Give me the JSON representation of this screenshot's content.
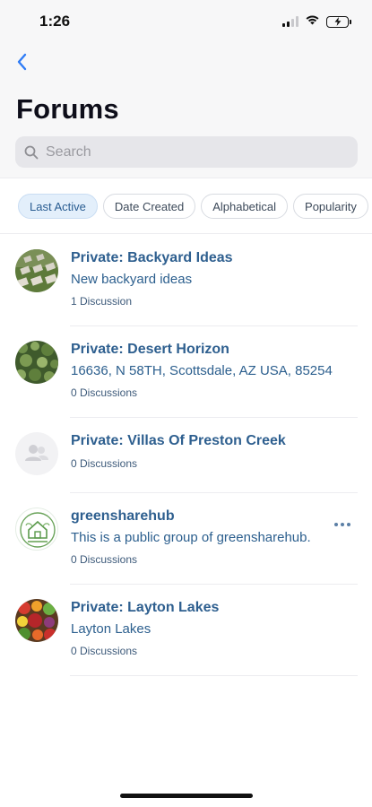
{
  "status": {
    "time": "1:26"
  },
  "page": {
    "title": "Forums"
  },
  "search": {
    "placeholder": "Search"
  },
  "filters": [
    {
      "label": "Last Active",
      "active": true
    },
    {
      "label": "Date Created",
      "active": false
    },
    {
      "label": "Alphabetical",
      "active": false
    },
    {
      "label": "Popularity",
      "active": false
    }
  ],
  "forums": [
    {
      "title": "Private: Backyard Ideas",
      "description": "New backyard ideas",
      "count": "1 Discussion"
    },
    {
      "title": "Private: Desert Horizon",
      "description": "16636, N 58TH, Scottsdale, AZ USA, 85254",
      "count": "0 Discussions"
    },
    {
      "title": "Private: Villas Of Preston Creek",
      "description": "",
      "count": "0 Discussions"
    },
    {
      "title": "greensharehub",
      "description": "This is a public group of greensharehub.",
      "count": "0 Discussions"
    },
    {
      "title": "Private: Layton Lakes",
      "description": "Layton Lakes",
      "count": "0 Discussions"
    }
  ],
  "colors": {
    "accent": "#2e5f8f",
    "chip_active_bg": "#e3effb",
    "top_bg": "#f7f7f8"
  },
  "icons": {
    "back": "chevron-left-icon",
    "search": "search-icon",
    "more": "ellipsis-icon",
    "group_placeholder": "group-icon"
  }
}
